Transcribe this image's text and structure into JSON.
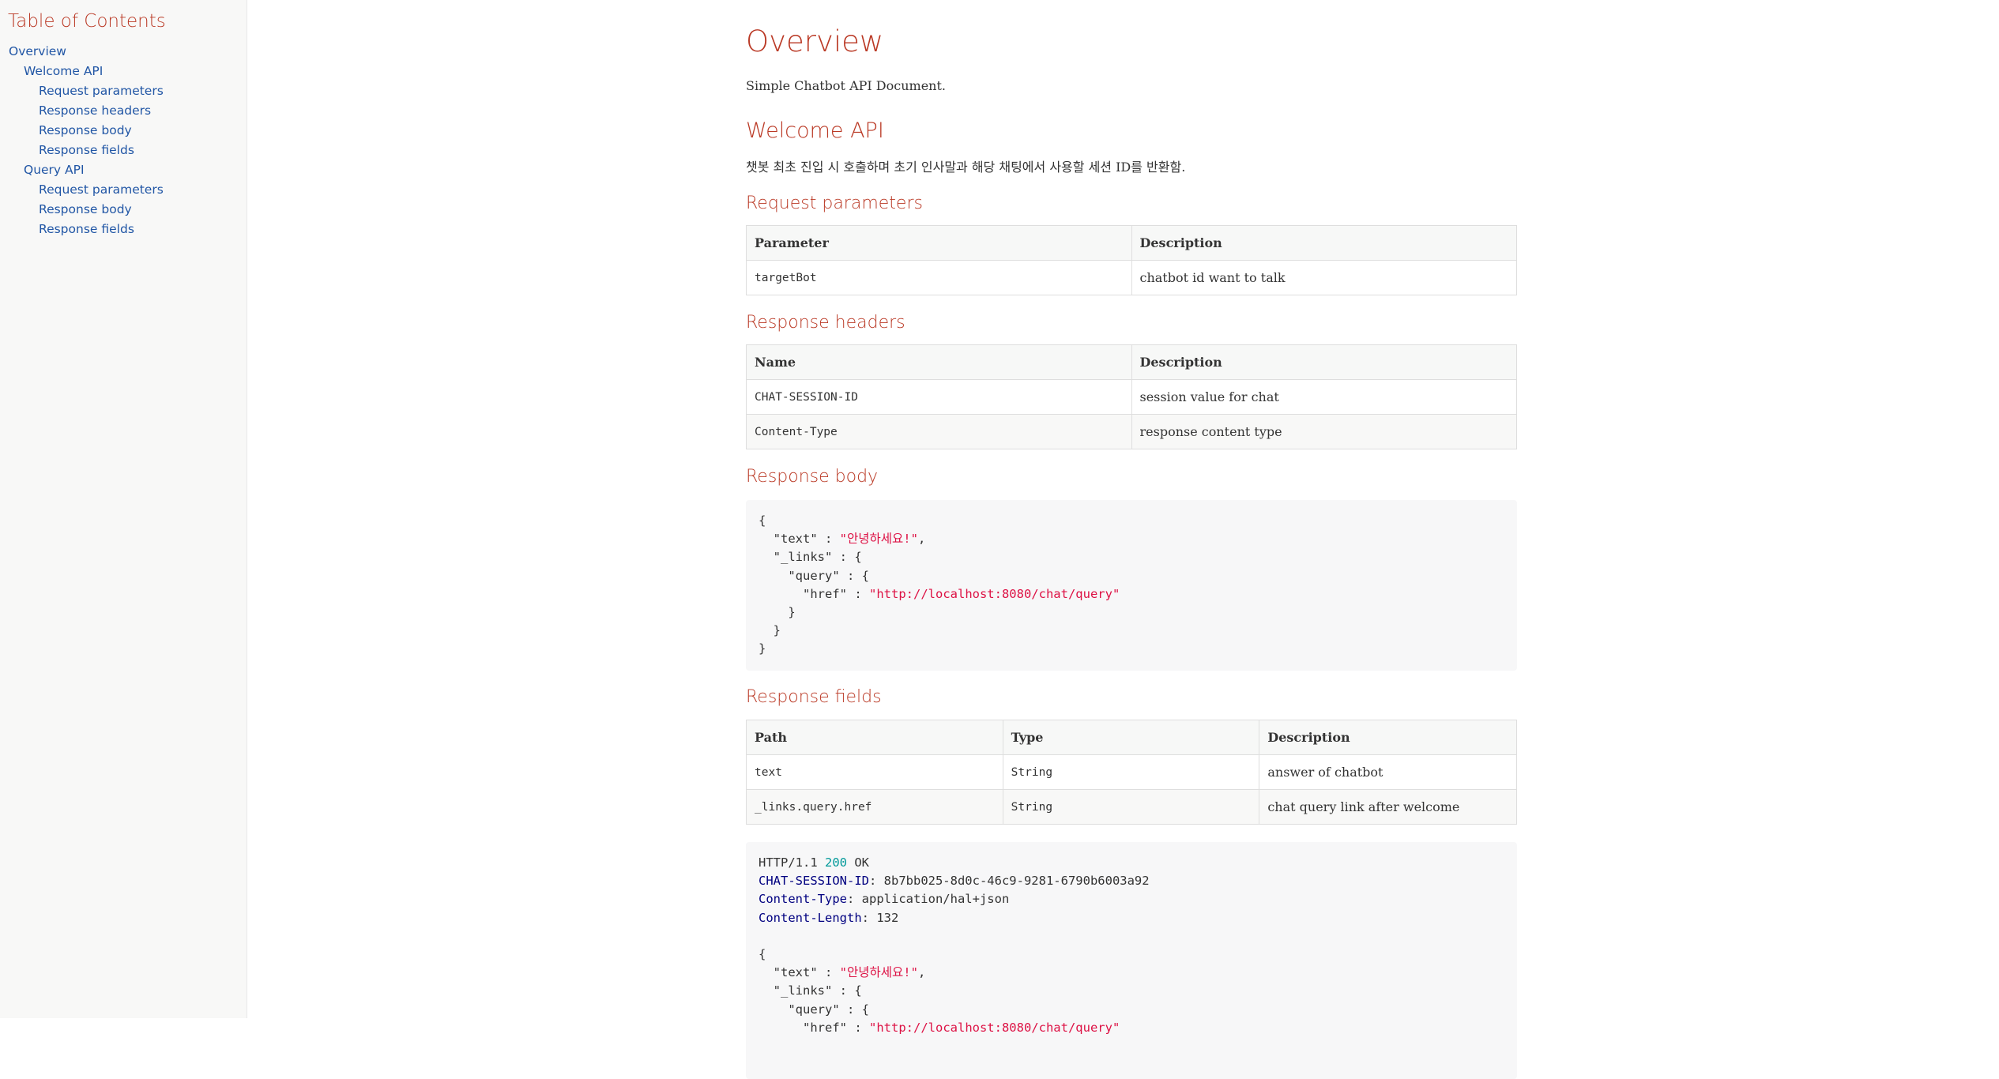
{
  "toc": {
    "title": "Table of Contents",
    "items": [
      {
        "label": "Overview",
        "level": 1
      },
      {
        "label": "Welcome API",
        "level": 2
      },
      {
        "label": "Request parameters",
        "level": 3
      },
      {
        "label": "Response headers",
        "level": 3
      },
      {
        "label": "Response body",
        "level": 3
      },
      {
        "label": "Response fields",
        "level": 3
      },
      {
        "label": "Query API",
        "level": 2
      },
      {
        "label": "Request parameters",
        "level": 3
      },
      {
        "label": "Response body",
        "level": 3
      },
      {
        "label": "Response fields",
        "level": 3
      }
    ]
  },
  "overview": {
    "title": "Overview",
    "text": "Simple Chatbot API Document."
  },
  "welcome": {
    "title": "Welcome API",
    "text": "챗봇 최초 진입 시 호출하며 초기 인사말과 해당 채팅에서 사용할 세션 ID를 반환함.",
    "request_parameters": {
      "title": "Request parameters",
      "headers": [
        "Parameter",
        "Description"
      ],
      "rows": [
        [
          "targetBot",
          "chatbot id want to talk"
        ]
      ]
    },
    "response_headers": {
      "title": "Response headers",
      "headers": [
        "Name",
        "Description"
      ],
      "rows": [
        [
          "CHAT-SESSION-ID",
          "session value for chat"
        ],
        [
          "Content-Type",
          "response content type"
        ]
      ]
    },
    "response_body": {
      "title": "Response body",
      "open": "{",
      "text_key": "\"text\"",
      "text_value": "\"안녕하세요!\"",
      "links_key": "\"_links\"",
      "query_key": "\"query\"",
      "href_key": "\"href\"",
      "href_value": "\"http://localhost:8080/chat/query\""
    },
    "response_fields": {
      "title": "Response fields",
      "headers": [
        "Path",
        "Type",
        "Description"
      ],
      "rows": [
        [
          "text",
          "String",
          "answer of chatbot"
        ],
        [
          "_links.query.href",
          "String",
          "chat query link after welcome"
        ]
      ]
    },
    "http_response": {
      "proto": "HTTP/1.1",
      "status": "200",
      "reason": "OK",
      "headers": [
        [
          "CHAT-SESSION-ID",
          "8b7bb025-8d0c-46c9-9281-6790b6003a92"
        ],
        [
          "Content-Type",
          "application/hal+json"
        ],
        [
          "Content-Length",
          "132"
        ]
      ]
    }
  },
  "colors": {
    "heading": "#ba3925",
    "link": "#2156a5",
    "string": "#dd1144",
    "number": "#009999",
    "header_key": "#000080"
  }
}
